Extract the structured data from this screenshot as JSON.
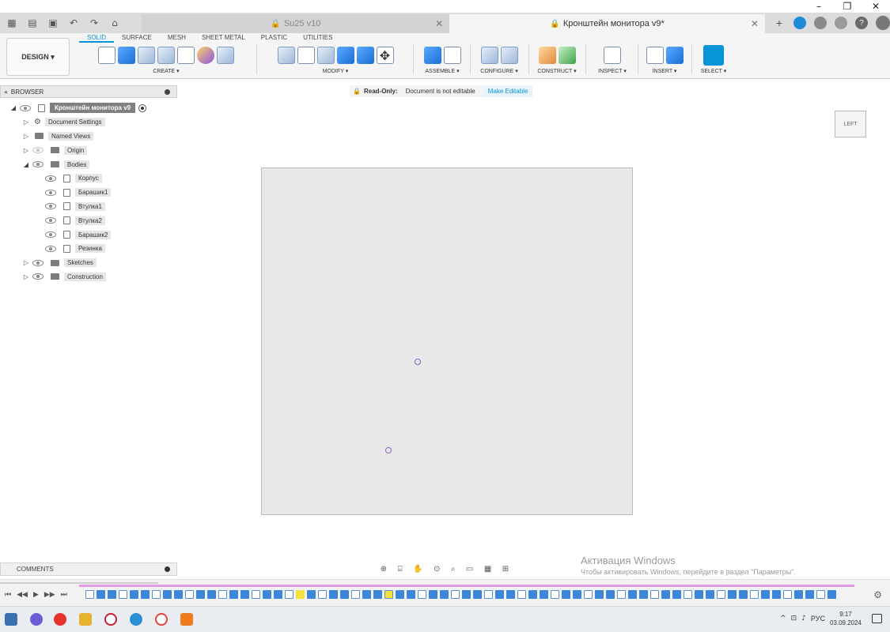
{
  "window_controls": {
    "minimize": "–",
    "restore": "❐",
    "close": "✕"
  },
  "tabs": [
    {
      "label": "Su25 v10",
      "active": false
    },
    {
      "label": "Кронштейн монитора v9*",
      "active": true
    }
  ],
  "tab_close": "✕",
  "tab_add": "+",
  "workspace_button": "DESIGN ▾",
  "ribbon_tabs": [
    "SOLID",
    "SURFACE",
    "MESH",
    "SHEET METAL",
    "PLASTIC",
    "UTILITIES"
  ],
  "tool_groups": [
    "CREATE ▾",
    "MODIFY ▾",
    "ASSEMBLE ▾",
    "CONFIGURE ▾",
    "CONSTRUCT ▾",
    "INSPECT ▾",
    "INSERT ▾",
    "SELECT ▾"
  ],
  "browser": {
    "title": "BROWSER",
    "root": "Кронштейн монитора v9",
    "items": [
      {
        "label": "Document Settings",
        "type": "gear"
      },
      {
        "label": "Named Views",
        "type": "folder"
      },
      {
        "label": "Origin",
        "type": "folder"
      },
      {
        "label": "Bodies",
        "type": "folder"
      }
    ],
    "bodies": [
      "Корпус",
      "Барашик1",
      "Втулка1",
      "Втулка2",
      "Барашик2",
      "Резинка"
    ],
    "trailing": [
      "Sketches",
      "Construction"
    ]
  },
  "readonly": {
    "label": "Read-Only:",
    "message": "Document is not editable",
    "action": "Make Editable"
  },
  "viewcube_label": "LEFT",
  "comments_label": "COMMENTS",
  "activation": {
    "line1": "Активация Windows",
    "line2": "Чтобы активировать Windows, перейдите в раздел \"Параметры\"."
  },
  "tray": {
    "language": "РУС",
    "time": "9:17",
    "date": "03.09.2024"
  }
}
